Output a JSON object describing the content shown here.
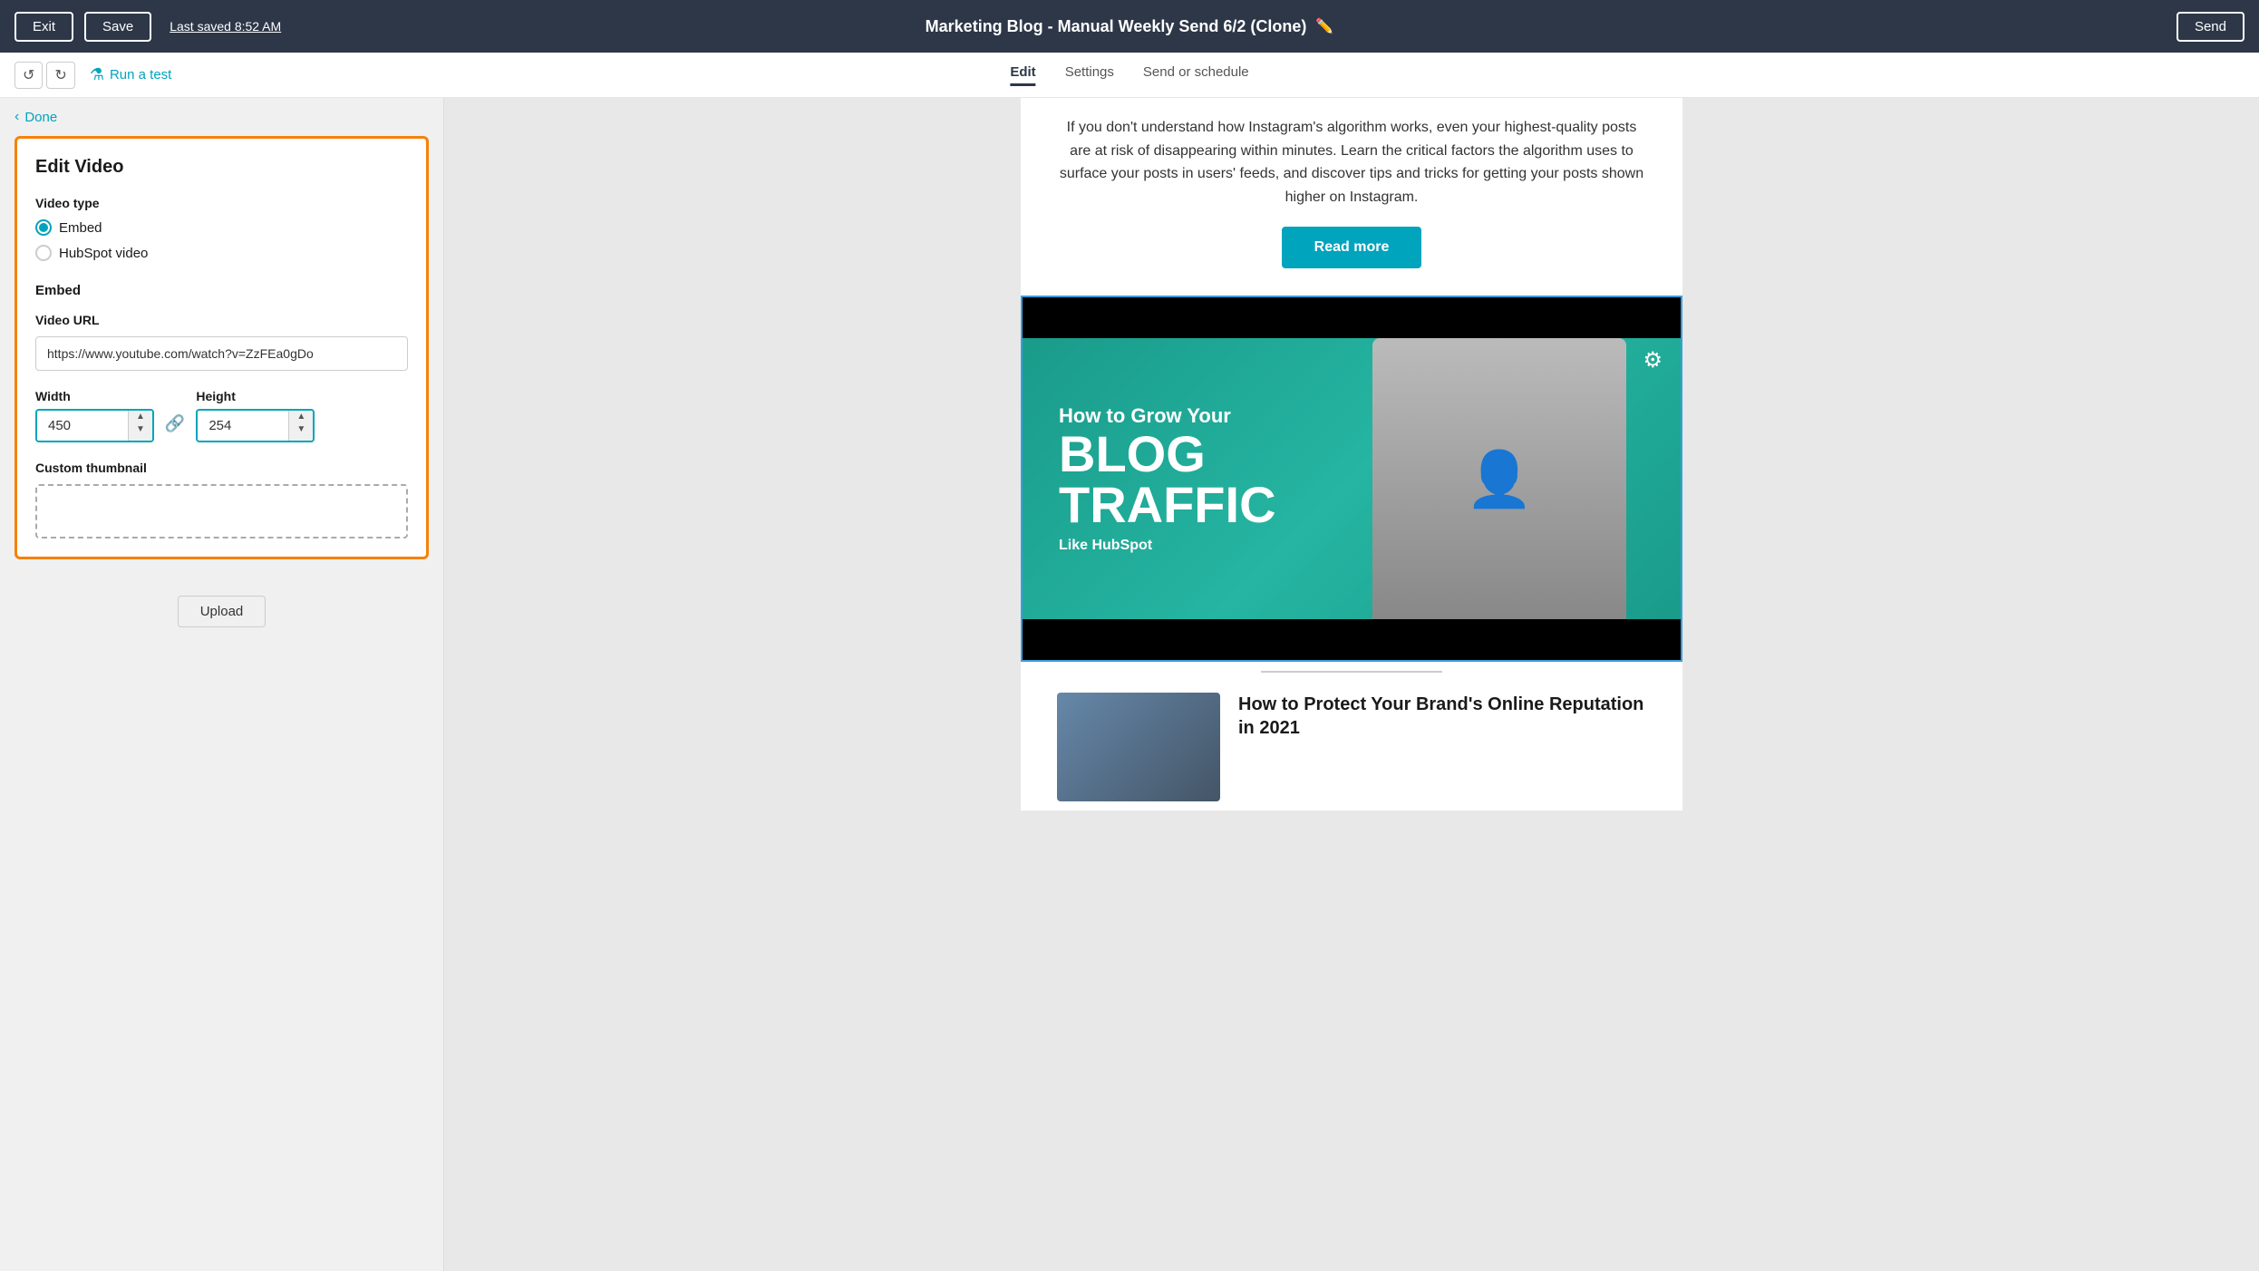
{
  "topbar": {
    "exit_label": "Exit",
    "save_label": "Save",
    "last_saved": "Last saved 8:52 AM",
    "title": "Marketing Blog - Manual Weekly Send 6/2 (Clone)",
    "send_label": "Send"
  },
  "secondary_nav": {
    "run_test_label": "Run a test",
    "tabs": [
      "Edit",
      "Settings",
      "Send or schedule"
    ],
    "active_tab": "Edit"
  },
  "left_panel": {
    "done_label": "Done",
    "edit_video": {
      "title": "Edit Video",
      "video_type_label": "Video type",
      "radio_options": [
        "Embed",
        "HubSpot video"
      ],
      "selected_radio": "Embed",
      "embed_section_label": "Embed",
      "video_url_label": "Video URL",
      "video_url_value": "https://www.youtube.com/watch?v=ZzFEa0gDo",
      "width_label": "Width",
      "width_value": "450",
      "height_label": "Height",
      "height_value": "254",
      "custom_thumbnail_label": "Custom thumbnail",
      "upload_label": "Upload"
    }
  },
  "right_panel": {
    "preview_paragraph": "If you don't understand how Instagram's algorithm works, even your highest-quality posts are at risk of disappearing within minutes. Learn the critical factors the algorithm uses to surface your posts in users' feeds, and discover tips and tricks for getting your posts shown higher on Instagram.",
    "read_more_label": "Read more",
    "video": {
      "how_to": "How to Grow Your",
      "blog": "BLOG",
      "traffic": "TRAFFIC",
      "like": "Like HubSpot"
    },
    "next_article": {
      "title": "How to Protect Your Brand's Online Reputation in 2021"
    }
  }
}
